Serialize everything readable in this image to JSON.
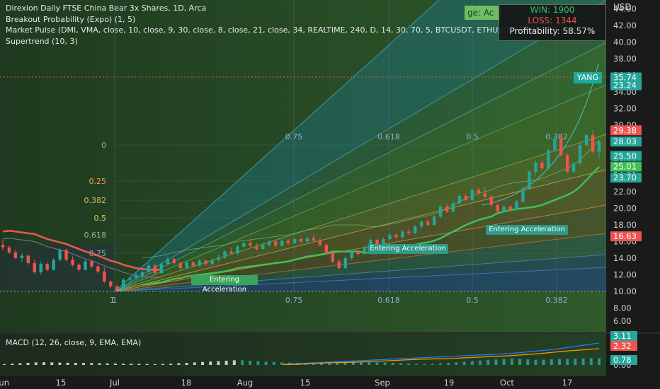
{
  "legend": {
    "title": "Direxion Daily FTSE China Bear 3x Shares, 1D, Arca",
    "line2": "Breakout Probability (Expo) (1, 5)",
    "line3": "Market Pulse (DMI, VMA, close, 10, close, 9, 30, close, 8, close, 21, close, 34, REALTIME, 240, D, 14, 30, 70, 5, BTCUSDT, ETHUSDT, BNBUSDT, ADA",
    "line4": "Supertrend (10, 3)"
  },
  "stats": {
    "win": "WIN: 1900",
    "loss": "LOSS: 1344",
    "profit": "Profitability: 58.57%"
  },
  "tag": "ge: Ac",
  "currency": "USD",
  "yang": "YANG",
  "annotations": [
    "Entering Acceleration",
    "Entering Acceleration",
    "Entering Acceleration"
  ],
  "fib_left": [
    "0",
    "0.25",
    "0.382",
    "0.5",
    "0.618",
    "0.75",
    "1"
  ],
  "fib_top": [
    "0.75",
    "0.618",
    "0.5",
    "0.382"
  ],
  "fib_bottom": [
    "1",
    "0.75",
    "0.618",
    "0.5",
    "0.382"
  ],
  "macd_legend": "MACD (12, 26, close, 9, EMA, EMA)",
  "colors": {
    "up": "#26a69a",
    "down": "#ef5350",
    "accent_green": "#3fbf55",
    "supertrend": "#ef5350",
    "background": "#1a1a1a"
  },
  "chart_data": {
    "type": "candlestick",
    "title": "Direxion Daily FTSE China Bear 3x Shares, 1D, Arca",
    "y_axis": {
      "min": 6,
      "max": 44,
      "ticks": [
        "44.00",
        "42.00",
        "40.00",
        "38.00",
        "36.00",
        "34.00",
        "32.00",
        "30.00",
        "28.00",
        "26.00",
        "24.00",
        "22.00",
        "20.00",
        "18.00",
        "16.00",
        "14.00",
        "12.00",
        "10.00",
        "8.00",
        "6.00"
      ]
    },
    "x_axis": {
      "ticks": [
        "Jun",
        "15",
        "Jul",
        "18",
        "Aug",
        "15",
        "Sep",
        "19",
        "Oct",
        "17"
      ]
    },
    "price_labels": [
      {
        "value": 35.74,
        "text": "35.74",
        "color": "#26a69a"
      },
      {
        "value": 34.8,
        "text": "23.24",
        "color": "#26a69a"
      },
      {
        "value": 29.38,
        "text": "29.38",
        "color": "#ef5350"
      },
      {
        "value": 28.03,
        "text": "28.03",
        "color": "#26a69a"
      },
      {
        "value": 26.3,
        "text": "25.50",
        "color": "#26a69a"
      },
      {
        "value": 25.01,
        "text": "25.01",
        "color": "#3fbf55"
      },
      {
        "value": 23.7,
        "text": "23.70",
        "color": "#26a69a"
      },
      {
        "value": 16.63,
        "text": "16.63",
        "color": "#ef5350"
      }
    ],
    "candles": [
      [
        15.6,
        16.2,
        15.0,
        15.3
      ],
      [
        15.3,
        15.5,
        14.5,
        14.7
      ],
      [
        14.7,
        15.0,
        13.9,
        14.0
      ],
      [
        14.0,
        14.6,
        13.5,
        14.3
      ],
      [
        14.3,
        14.4,
        13.2,
        13.4
      ],
      [
        13.4,
        13.8,
        12.1,
        12.3
      ],
      [
        12.3,
        13.6,
        12.0,
        13.3
      ],
      [
        13.3,
        13.5,
        12.4,
        12.6
      ],
      [
        12.6,
        14.0,
        12.5,
        13.8
      ],
      [
        13.8,
        15.2,
        13.6,
        15.0
      ],
      [
        15.0,
        15.1,
        13.6,
        13.8
      ],
      [
        13.8,
        14.2,
        13.0,
        13.2
      ],
      [
        13.2,
        13.4,
        12.4,
        12.6
      ],
      [
        12.6,
        13.8,
        12.5,
        13.6
      ],
      [
        13.6,
        13.7,
        12.8,
        13.0
      ],
      [
        13.0,
        13.2,
        12.2,
        12.4
      ],
      [
        12.4,
        12.9,
        11.0,
        11.2
      ],
      [
        11.2,
        11.3,
        10.4,
        10.6
      ],
      [
        10.6,
        10.8,
        10.0,
        10.2
      ],
      [
        10.2,
        11.6,
        10.1,
        11.4
      ],
      [
        11.4,
        11.8,
        11.0,
        11.6
      ],
      [
        11.6,
        12.2,
        11.4,
        11.9
      ],
      [
        11.9,
        12.4,
        11.5,
        12.3
      ],
      [
        12.3,
        13.4,
        12.1,
        13.1
      ],
      [
        13.1,
        13.3,
        12.0,
        12.2
      ],
      [
        12.2,
        13.5,
        12.1,
        13.3
      ],
      [
        13.3,
        14.2,
        13.1,
        13.9
      ],
      [
        13.9,
        14.1,
        13.2,
        13.4
      ],
      [
        13.4,
        13.6,
        12.6,
        12.8
      ],
      [
        12.8,
        13.7,
        12.7,
        13.5
      ],
      [
        13.5,
        13.6,
        12.9,
        13.1
      ],
      [
        13.1,
        13.9,
        13.0,
        13.7
      ],
      [
        13.7,
        13.8,
        13.1,
        13.3
      ],
      [
        13.3,
        14.0,
        13.2,
        13.8
      ],
      [
        13.8,
        14.4,
        13.6,
        14.1
      ],
      [
        14.1,
        15.0,
        13.9,
        14.8
      ],
      [
        14.8,
        15.3,
        14.4,
        14.6
      ],
      [
        14.6,
        15.6,
        14.4,
        15.4
      ],
      [
        15.4,
        16.0,
        15.2,
        15.8
      ],
      [
        15.8,
        16.4,
        15.3,
        15.5
      ],
      [
        15.5,
        15.8,
        14.9,
        15.1
      ],
      [
        15.1,
        15.9,
        15.0,
        15.6
      ],
      [
        15.6,
        16.2,
        15.4,
        16.0
      ],
      [
        16.0,
        16.1,
        15.3,
        15.5
      ],
      [
        15.5,
        16.3,
        15.4,
        16.1
      ],
      [
        16.1,
        16.3,
        15.6,
        15.8
      ],
      [
        15.8,
        16.5,
        15.7,
        16.3
      ],
      [
        16.3,
        16.5,
        15.8,
        16.0
      ],
      [
        16.0,
        16.6,
        15.9,
        16.4
      ],
      [
        16.4,
        16.8,
        15.9,
        16.1
      ],
      [
        16.1,
        16.4,
        15.4,
        15.6
      ],
      [
        15.6,
        15.8,
        14.4,
        14.6
      ],
      [
        14.6,
        14.8,
        13.4,
        13.6
      ],
      [
        13.6,
        13.9,
        12.6,
        12.8
      ],
      [
        12.8,
        14.2,
        12.7,
        14.0
      ],
      [
        14.0,
        15.0,
        13.8,
        14.8
      ],
      [
        14.8,
        15.1,
        14.3,
        14.5
      ],
      [
        14.5,
        15.5,
        14.4,
        15.3
      ],
      [
        15.3,
        16.4,
        15.1,
        16.2
      ],
      [
        16.2,
        16.4,
        15.5,
        15.7
      ],
      [
        15.7,
        16.5,
        15.6,
        16.3
      ],
      [
        16.3,
        17.0,
        16.1,
        16.8
      ],
      [
        16.8,
        17.0,
        16.3,
        16.5
      ],
      [
        16.5,
        17.4,
        16.4,
        17.2
      ],
      [
        17.2,
        17.6,
        16.8,
        17.0
      ],
      [
        17.0,
        18.0,
        16.9,
        17.8
      ],
      [
        17.8,
        18.6,
        17.6,
        18.4
      ],
      [
        18.4,
        18.6,
        17.8,
        18.0
      ],
      [
        18.0,
        19.2,
        17.9,
        19.0
      ],
      [
        19.0,
        20.4,
        18.8,
        20.2
      ],
      [
        20.2,
        20.6,
        19.4,
        19.6
      ],
      [
        19.6,
        20.8,
        19.5,
        20.6
      ],
      [
        20.6,
        21.8,
        20.4,
        21.5
      ],
      [
        21.5,
        21.8,
        20.8,
        21.0
      ],
      [
        21.0,
        22.4,
        20.9,
        22.2
      ],
      [
        22.2,
        22.5,
        21.6,
        21.8
      ],
      [
        21.8,
        22.6,
        21.2,
        21.4
      ],
      [
        21.4,
        21.6,
        20.2,
        20.4
      ],
      [
        20.4,
        20.6,
        19.4,
        19.6
      ],
      [
        19.6,
        20.4,
        19.5,
        20.2
      ],
      [
        20.2,
        20.4,
        19.6,
        19.8
      ],
      [
        19.8,
        21.0,
        19.7,
        20.8
      ],
      [
        20.8,
        22.6,
        20.6,
        22.4
      ],
      [
        22.4,
        24.6,
        22.2,
        24.4
      ],
      [
        24.4,
        25.8,
        24.0,
        25.5
      ],
      [
        25.5,
        25.8,
        24.6,
        24.8
      ],
      [
        24.8,
        27.2,
        24.6,
        27.0
      ],
      [
        27.0,
        28.6,
        26.8,
        28.4
      ],
      [
        28.4,
        28.8,
        26.2,
        26.4
      ],
      [
        26.4,
        26.6,
        24.2,
        24.4
      ],
      [
        24.4,
        25.6,
        24.2,
        25.4
      ],
      [
        25.4,
        27.8,
        25.2,
        27.6
      ],
      [
        27.6,
        29.0,
        27.4,
        28.8
      ],
      [
        28.8,
        29.4,
        26.6,
        26.8
      ],
      [
        26.8,
        28.2,
        26.0,
        28.03
      ]
    ],
    "supertrend_red": [
      17.2,
      17.3,
      17.2,
      17.1,
      17.0,
      16.9,
      16.6,
      16.3,
      16.1,
      15.9,
      15.7,
      15.4,
      15.1,
      14.8,
      14.6,
      14.3,
      14.0,
      13.7,
      13.5,
      13.2,
      13.0,
      12.8,
      12.7,
      12.6,
      12.6,
      12.6
    ],
    "supertrend_green": [
      10.8,
      10.9,
      11.0,
      11.1,
      11.3,
      11.5,
      11.6,
      11.8,
      11.9,
      12.0,
      12.1,
      12.2,
      12.3,
      12.4,
      12.6,
      12.8,
      12.9,
      13.0,
      13.1,
      13.2,
      13.3,
      13.4,
      13.5,
      13.6,
      13.8,
      14.0,
      14.2,
      14.3,
      14.4,
      14.6,
      14.8,
      14.8,
      14.8,
      14.8,
      14.8,
      14.7,
      14.6,
      14.6,
      14.7,
      14.9,
      15.0,
      15.2,
      15.4,
      15.6,
      15.8,
      15.9,
      16.1,
      16.4,
      16.8,
      17.2,
      17.6,
      18.0,
      18.3,
      18.6,
      18.8,
      19.0,
      19.4,
      19.6,
      19.8,
      19.9,
      20.0,
      20.1,
      20.2,
      20.4,
      20.7,
      21.0,
      21.3,
      21.6,
      22.0,
      22.6,
      23.4,
      24.2,
      25.01
    ],
    "macd": {
      "y_ticks": [
        "6.00",
        "0.00"
      ],
      "labels": [
        {
          "text": "3.11",
          "color": "#26a69a"
        },
        {
          "text": "2.32",
          "color": "#ef5350"
        },
        {
          "text": "0.78",
          "color": "#26a69a"
        }
      ],
      "histogram": [
        0.1,
        0.15,
        0.2,
        0.25,
        0.3,
        0.32,
        0.3,
        0.28,
        0.26,
        0.25,
        0.24,
        0.22,
        0.2,
        0.18,
        0.16,
        0.15,
        0.14,
        0.13,
        0.12,
        0.1,
        0.12,
        0.15,
        0.2,
        0.25,
        0.3,
        0.35,
        0.4,
        0.45,
        0.5,
        0.55,
        0.55,
        0.5,
        0.45,
        0.4,
        0.35,
        0.3,
        0.28,
        0.26,
        0.25,
        0.3,
        0.35,
        0.38,
        0.4,
        0.42,
        0.45,
        0.4,
        0.35,
        0.3,
        0.28,
        0.25,
        0.2,
        0.15,
        0.12,
        0.1,
        0.12,
        0.18,
        0.25,
        0.32,
        0.38,
        0.45,
        0.52,
        0.6,
        0.65,
        0.7,
        0.75,
        0.7,
        0.65,
        0.6,
        0.62,
        0.66,
        0.7,
        0.72,
        0.75,
        0.78,
        0.8,
        0.78
      ],
      "macd_line": [
        0.1,
        0.2,
        0.3,
        0.4,
        0.5,
        0.6,
        0.7,
        0.8,
        0.9,
        1.0,
        1.1,
        1.2,
        1.3,
        1.4,
        1.5,
        1.6,
        1.8,
        2.0,
        2.2,
        2.5,
        2.8,
        3.11
      ],
      "signal_line": [
        0.05,
        0.1,
        0.2,
        0.3,
        0.35,
        0.4,
        0.5,
        0.6,
        0.7,
        0.8,
        0.85,
        0.9,
        1.0,
        1.1,
        1.2,
        1.3,
        1.45,
        1.6,
        1.8,
        2.0,
        2.15,
        2.32
      ]
    }
  }
}
